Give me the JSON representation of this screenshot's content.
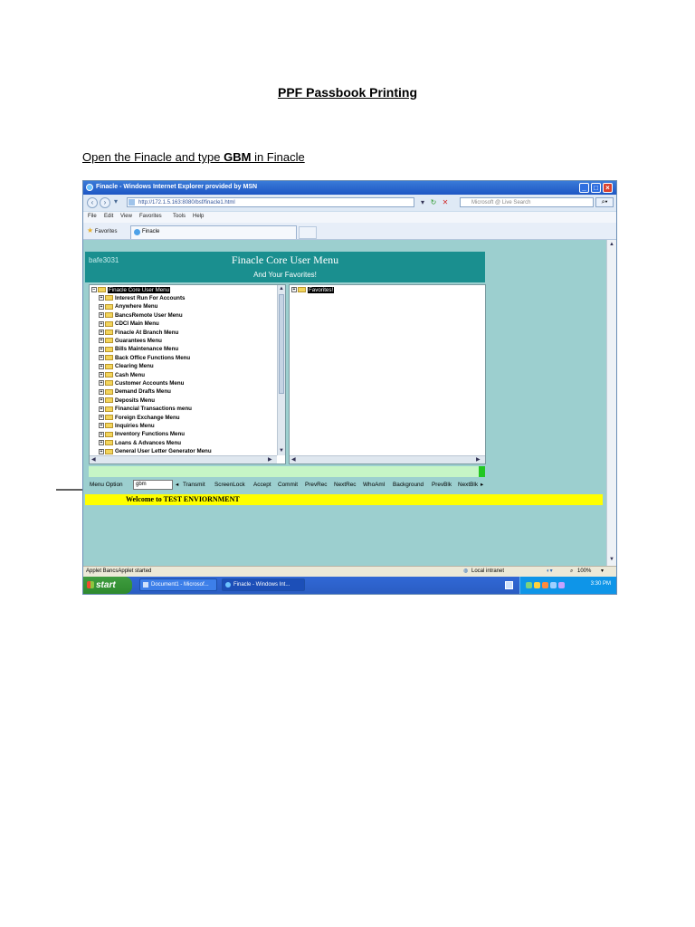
{
  "document": {
    "title": "PPF Passbook Printing",
    "instruction_prefix": "Open the Finacle and type ",
    "instruction_bold": "GBM",
    "instruction_suffix": " in Finacle"
  },
  "browser": {
    "window_title": "Finacle - Windows Internet Explorer provided by MSN",
    "url": "http://172.1.5.163:8080/bsf/finacle1.html",
    "search_placeholder": "Microsoft @ Live Search",
    "menu": [
      "File",
      "Edit",
      "View",
      "Favorites",
      "Tools",
      "Help"
    ],
    "favorites_label": "Favorites",
    "tab_label": "Finacle",
    "status_left": "Applet BancsApplet started",
    "status_zone": "Local intranet",
    "zoom": "100%"
  },
  "finacle": {
    "user_id": "bafe3031",
    "heading": "Finacle Core User Menu",
    "subheading": "And Your Favorites!",
    "tree_root": "Finacle Core User Menu",
    "tree_items": [
      "Interest Run For Accounts",
      "Anywhere Menu",
      "BancsRemote User Menu",
      "CDCI Main Menu",
      "Finacle At Branch Menu",
      "Guarantees Menu",
      "Bills Maintenance Menu",
      "Back Office Functions Menu",
      "Clearing Menu",
      "Cash Menu",
      "Customer Accounts Menu",
      "Demand Drafts Menu",
      "Deposits Menu",
      "Financial Transactions menu",
      "Foreign Exchange Menu",
      "Inquiries Menu",
      "Inventory Functions Menu",
      "Loans & Advances Menu",
      "General User Letter Generator Menu"
    ],
    "favorites_root": "Favorites!",
    "menu_option_label": "Menu Option",
    "menu_option_value": "gbm",
    "commands": [
      "Transmit",
      "ScreenLock",
      "Accept",
      "Commit",
      "PrevRec",
      "NextRec",
      "WhoAmI",
      "Background",
      "PrevBlk",
      "NextBlk"
    ],
    "welcome": "Welcome to TEST ENVIORNMENT"
  },
  "taskbar": {
    "start": "start",
    "tasks": [
      "Document1 - Microsof...",
      "Finacle - Windows Int..."
    ],
    "clock": "3:30 PM"
  }
}
